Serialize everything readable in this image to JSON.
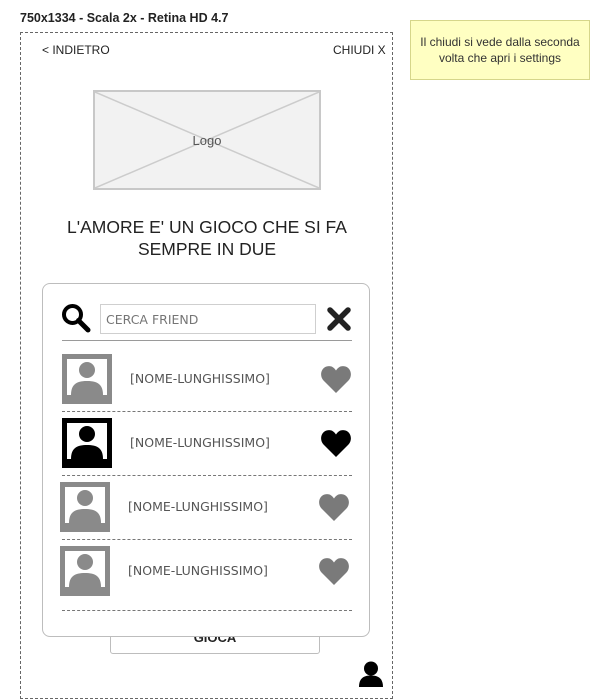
{
  "frame": {
    "title": "750x1334 - Scala 2x - Retina HD 4.7"
  },
  "nav": {
    "back_label": "< INDIETRO",
    "close_label": "CHIUDI X"
  },
  "logo": {
    "label": "Logo"
  },
  "headline": {
    "line1": "L'AMORE E' UN GIOCO CHE SI FA",
    "line2": "SEMPRE IN DUE"
  },
  "search": {
    "placeholder": "CERCA FRIEND",
    "value": ""
  },
  "friends": [
    {
      "name": "[NOME-LUNGHISSIMO]",
      "selected": false
    },
    {
      "name": "[NOME-LUNGHISSIMO]",
      "selected": true
    },
    {
      "name": "[NOME-LUNGHISSIMO]",
      "selected": false
    },
    {
      "name": "[NOME-LUNGHISSIMO]",
      "selected": false
    }
  ],
  "play_button": {
    "label": "GIOCA"
  },
  "note": {
    "text": "Il chiudi si vede dalla seconda volta che apri i settings"
  },
  "icons": {
    "search": "search-icon",
    "clear": "close-icon",
    "heart": "heart-icon",
    "avatar": "user-placeholder-icon",
    "profile": "user-icon"
  },
  "colors": {
    "heart_inactive": "#7a7a7a",
    "heart_active": "#000000",
    "avatar_inactive": "#8a8a8a",
    "avatar_active": "#000000",
    "note_background": "#ffffc2"
  }
}
